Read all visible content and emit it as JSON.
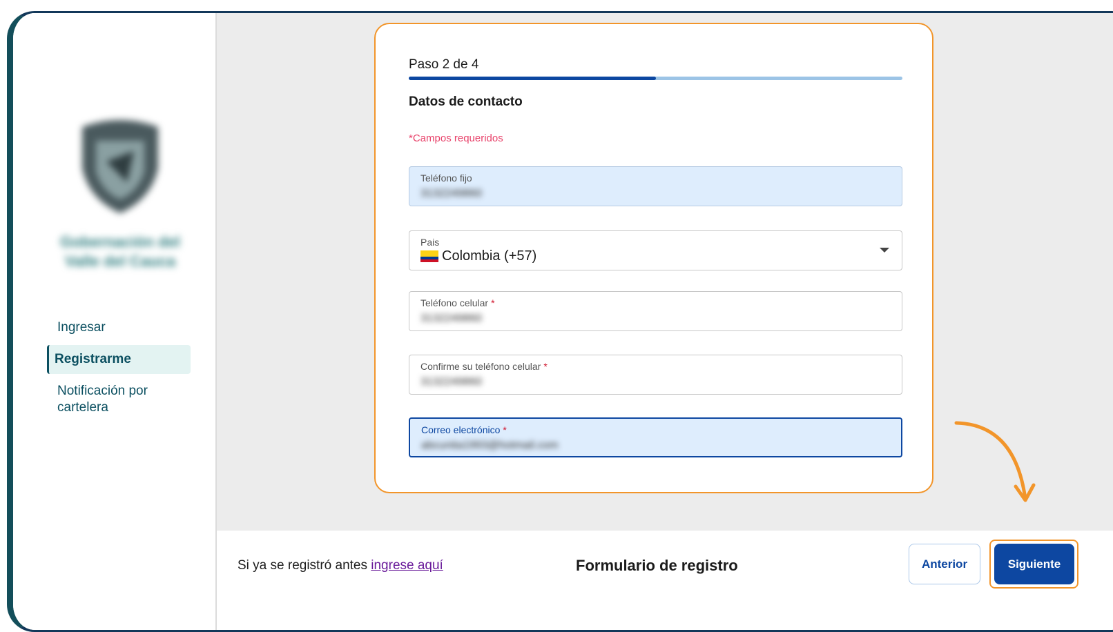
{
  "sidebar": {
    "org_name": "Gobernación del Valle del Cauca",
    "nav": [
      {
        "label": "Ingresar"
      },
      {
        "label": "Registrarme"
      },
      {
        "label": "Notificación por cartelera"
      }
    ]
  },
  "form": {
    "step_label": "Paso 2 de 4",
    "progress": 0.5,
    "section_title": "Datos de contacto",
    "required_note": "*Campos requeridos",
    "fields": {
      "landline": {
        "label": "Teléfono fijo",
        "value": "3132249860"
      },
      "country": {
        "label": "Pais",
        "value": "Colombia (+57)"
      },
      "mobile": {
        "label": "Teléfono celular",
        "required": "*",
        "value": "3132249860"
      },
      "mobile_confirm": {
        "label": "Confirme su teléfono celular",
        "required": "*",
        "value": "3132249860"
      },
      "email": {
        "label": "Correo electrónico",
        "required": "*",
        "value": "abcunita1993@hotmail.com"
      }
    }
  },
  "footer": {
    "text": "Si ya se registró antes",
    "link": "ingrese aquí",
    "title": "Formulario de registro",
    "prev_label": "Anterior",
    "next_label": "Siguiente"
  },
  "colors": {
    "accent": "#0d47a1",
    "highlight": "#f2952a",
    "required": "#e8426a"
  }
}
